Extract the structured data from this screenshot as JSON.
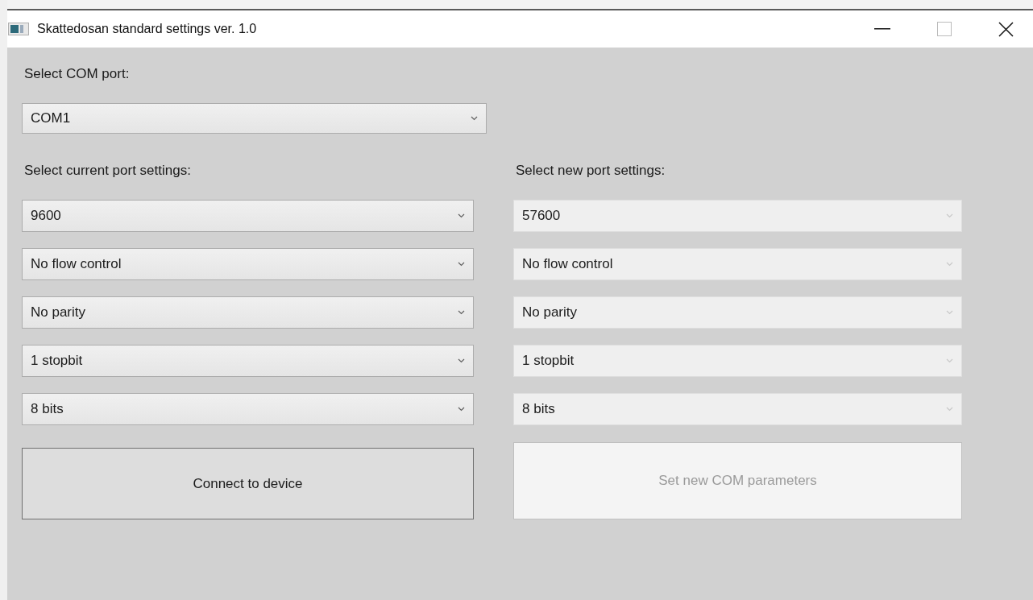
{
  "window": {
    "title": "Skattedosan standard settings ver. 1.0"
  },
  "com_port": {
    "label": "Select COM port:",
    "value": "COM1",
    "disabled": false
  },
  "current_settings": {
    "label": "Select current port settings:",
    "dropdowns": [
      {
        "value": "9600",
        "disabled": false
      },
      {
        "value": "No flow control",
        "disabled": false
      },
      {
        "value": "No parity",
        "disabled": false
      },
      {
        "value": "1 stopbit",
        "disabled": false
      },
      {
        "value": "8 bits",
        "disabled": false
      }
    ],
    "button": {
      "label": "Connect to device",
      "disabled": false
    }
  },
  "new_settings": {
    "label": "Select new port settings:",
    "dropdowns": [
      {
        "value": "57600",
        "disabled": true
      },
      {
        "value": "No flow control",
        "disabled": true
      },
      {
        "value": "No parity",
        "disabled": true
      },
      {
        "value": "1 stopbit",
        "disabled": true
      },
      {
        "value": "8 bits",
        "disabled": true
      }
    ],
    "button": {
      "label": "Set new COM parameters",
      "disabled": true
    }
  }
}
